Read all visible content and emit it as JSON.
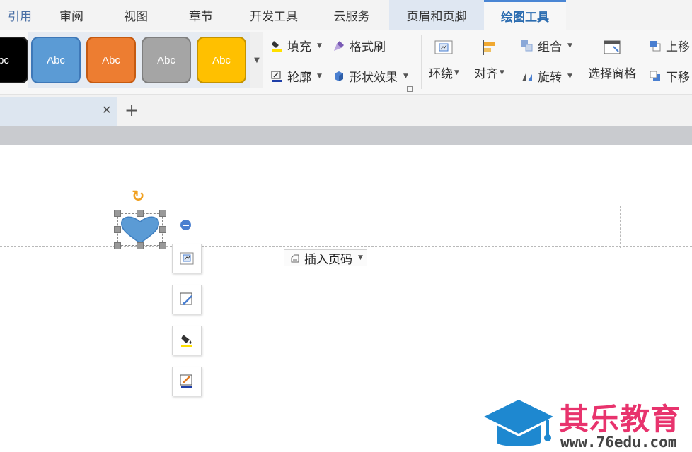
{
  "tabs": [
    {
      "label": "引用",
      "state": "partial"
    },
    {
      "label": "审阅",
      "state": "normal"
    },
    {
      "label": "视图",
      "state": "normal"
    },
    {
      "label": "章节",
      "state": "normal"
    },
    {
      "label": "开发工具",
      "state": "normal"
    },
    {
      "label": "云服务",
      "state": "normal"
    },
    {
      "label": "页眉和页脚",
      "state": "highlight"
    },
    {
      "label": "绘图工具",
      "state": "active"
    }
  ],
  "styles": [
    {
      "label": "bc",
      "fill": "#000000"
    },
    {
      "label": "Abc",
      "fill": "#5b9bd5"
    },
    {
      "label": "Abc",
      "fill": "#ed7d31"
    },
    {
      "label": "Abc",
      "fill": "#a5a5a5"
    },
    {
      "label": "Abc",
      "fill": "#ffc000"
    }
  ],
  "format": {
    "fill": "填充",
    "painter": "格式刷",
    "outline": "轮廓",
    "effects": "形状效果"
  },
  "arrange": {
    "wrap": "环绕",
    "align": "对齐",
    "group": "组合",
    "rotate": "旋转",
    "pane": "选择窗格",
    "bring_forward": "上移",
    "send_backward": "下移"
  },
  "document": {
    "insert_page_number": "插入页码",
    "shape_fill_color": "#5b9bd5"
  },
  "watermark": {
    "name": "其乐教育",
    "url": "www.76edu.com"
  },
  "colors": {
    "accent": "#4a86d4",
    "fill_marker": "#ffe000",
    "outline_marker": "#1f3fa8"
  }
}
